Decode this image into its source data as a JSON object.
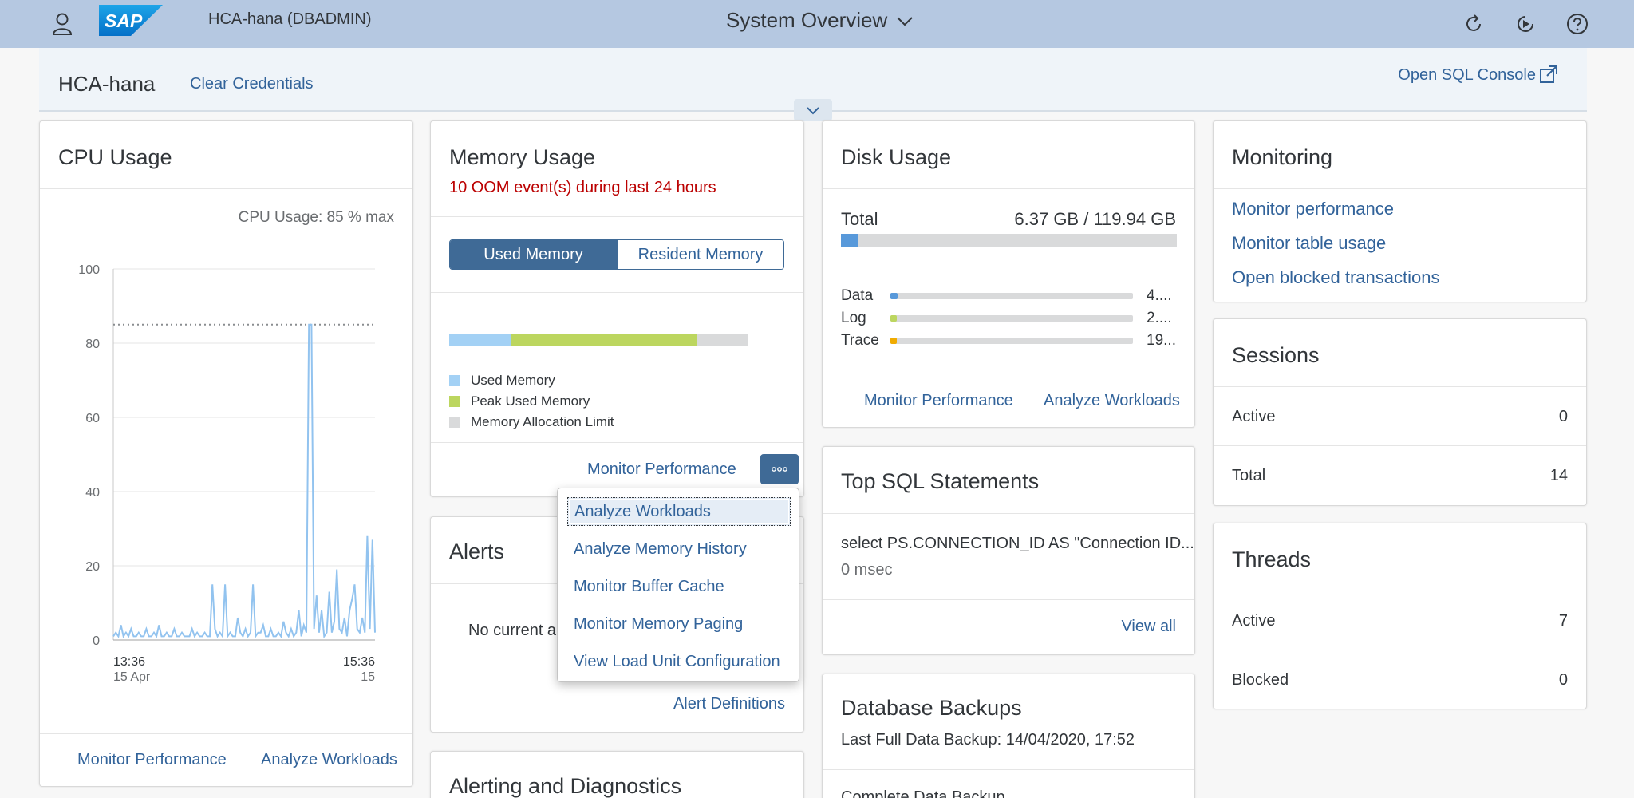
{
  "shell": {
    "system": "HCA-hana (DBADMIN)",
    "title": "System Overview",
    "logo": "SAP",
    "icons": [
      "user-icon",
      "refresh-icon",
      "play-circle-icon",
      "help-icon"
    ]
  },
  "subheader": {
    "name": "HCA-hana",
    "clear_credentials": "Clear Credentials",
    "open_sql_console": "Open SQL Console"
  },
  "cpu": {
    "title": "CPU Usage",
    "max_label": "CPU Usage: 85 % max",
    "links": [
      "Monitor Performance",
      "Analyze Workloads"
    ]
  },
  "memory": {
    "title": "Memory Usage",
    "warning": "10 OOM event(s) during last 24 hours",
    "tabs": [
      "Used Memory",
      "Resident Memory"
    ],
    "bar": {
      "used_fraction": 0.205,
      "peak_fraction": 0.83
    },
    "legend": [
      {
        "label": "Used Memory",
        "color": "#a3d1f5"
      },
      {
        "label": "Peak Used Memory",
        "color": "#bcd65f"
      },
      {
        "label": "Memory Allocation Limit",
        "color": "#d9dadb"
      }
    ],
    "link": "Monitor Performance",
    "more": "∘∘∘"
  },
  "menu": {
    "items": [
      "Analyze Workloads",
      "Analyze Memory History",
      "Monitor Buffer Cache",
      "Monitor Memory Paging",
      "View Load Unit Configuration"
    ]
  },
  "alerts": {
    "title": "Alerts",
    "empty": "No current a",
    "link": "Alert Definitions"
  },
  "alerting": {
    "title": "Alerting and Diagnostics"
  },
  "disk": {
    "title": "Disk Usage",
    "total_label": "Total",
    "total_value": "6.37 GB / 119.94 GB",
    "total_fraction": 0.05,
    "rows": [
      {
        "label": "Data",
        "value": "4....",
        "fraction": 0.03,
        "color": "#5899da"
      },
      {
        "label": "Log",
        "value": "2....",
        "fraction": 0.02,
        "color": "#bcd65f"
      },
      {
        "label": "Trace",
        "value": "19...",
        "fraction": 0.02,
        "color": "#f0ab00"
      }
    ],
    "links": [
      "Monitor Performance",
      "Analyze Workloads"
    ]
  },
  "topsql": {
    "title": "Top SQL Statements",
    "statement": "select PS.CONNECTION_ID AS \"Connection ID...",
    "duration": "0 msec",
    "link": "View all"
  },
  "backups": {
    "title": "Database Backups",
    "last": "Last Full Data Backup: 14/04/2020, 17:52",
    "next": "Complete Data Backup"
  },
  "monitoring": {
    "title": "Monitoring",
    "links": [
      "Monitor performance",
      "Monitor table usage",
      "Open blocked transactions"
    ]
  },
  "sessions": {
    "title": "Sessions",
    "rows": [
      {
        "label": "Active",
        "value": "0"
      },
      {
        "label": "Total",
        "value": "14"
      }
    ]
  },
  "threads": {
    "title": "Threads",
    "rows": [
      {
        "label": "Active",
        "value": "7"
      },
      {
        "label": "Blocked",
        "value": "0"
      }
    ]
  },
  "chart_data": {
    "type": "line",
    "title": "CPU Usage: 85 % max",
    "ylim": [
      0,
      100
    ],
    "yticks": [
      "100",
      "80",
      "60",
      "40",
      "20",
      "0"
    ],
    "max_line": 85,
    "x_start": {
      "time": "13:36",
      "date": "15 Apr"
    },
    "x_end": {
      "time": "15:36",
      "date": "15"
    },
    "series": [
      {
        "color": "#92c3ef",
        "values": [
          1,
          2,
          1,
          4,
          1,
          2,
          1,
          3,
          1,
          1,
          2,
          1,
          1,
          3,
          1,
          1,
          2,
          1,
          4,
          1,
          1,
          2,
          1,
          1,
          3,
          1,
          1,
          2,
          1,
          1,
          1,
          3,
          1,
          2,
          1,
          1,
          2,
          1,
          1,
          15,
          3,
          1,
          2,
          1,
          15,
          1,
          2,
          1,
          1,
          6,
          2,
          1,
          3,
          1,
          2,
          15,
          1,
          2,
          2,
          4,
          1,
          1,
          3,
          1,
          1,
          2,
          1,
          5,
          2,
          1,
          3,
          1,
          2,
          8,
          1,
          4,
          2,
          85,
          85,
          3,
          12,
          2,
          8,
          1,
          2,
          13,
          2,
          5,
          19,
          3,
          2,
          6,
          1,
          8,
          11,
          15,
          3,
          2,
          6,
          2,
          28,
          3,
          27,
          2
        ]
      }
    ]
  }
}
